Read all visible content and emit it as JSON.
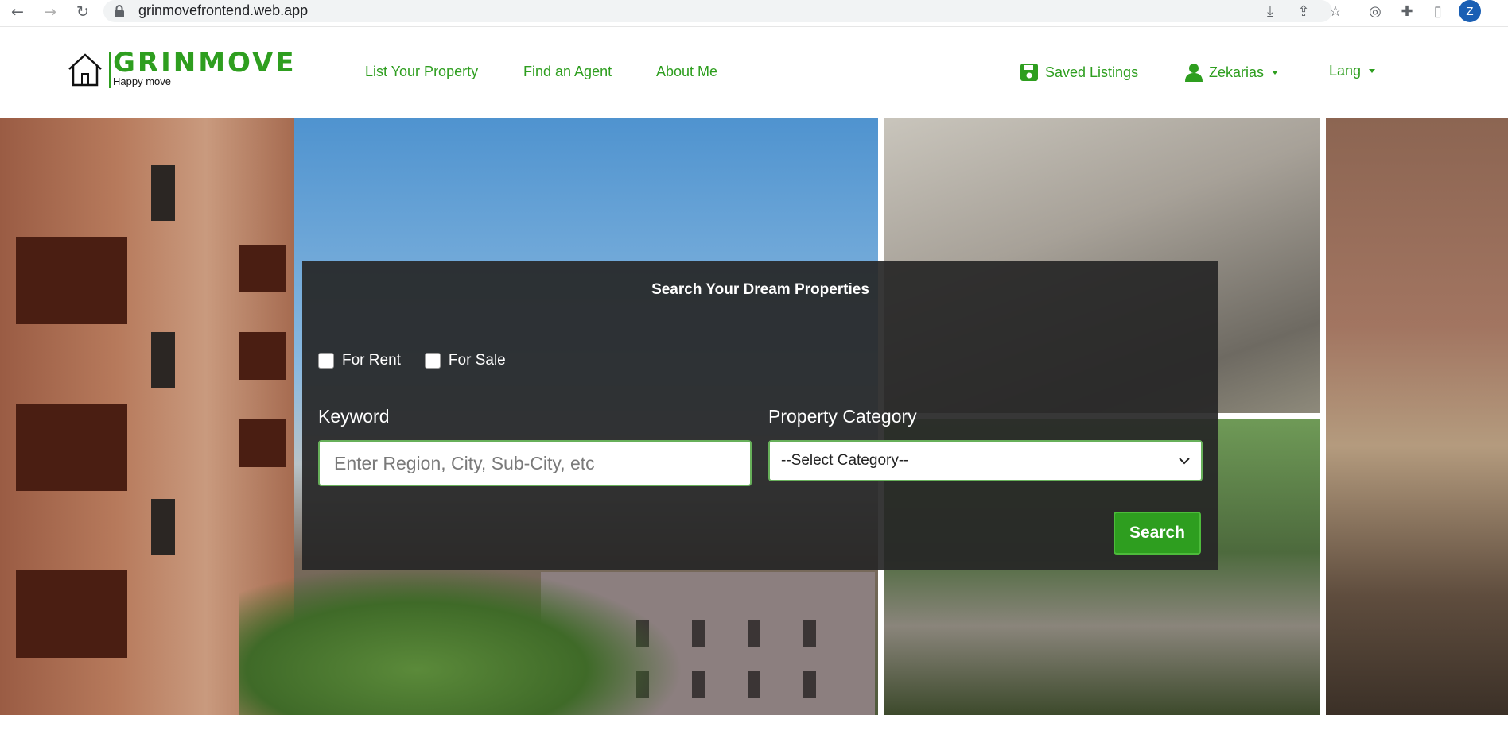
{
  "browser": {
    "url": "grinmovefrontend.web.app",
    "profile_initial": "Z"
  },
  "header": {
    "brand": "GRINMOVE",
    "tagline": "Happy move",
    "nav": [
      {
        "label": "List Your Property"
      },
      {
        "label": "Find an Agent"
      },
      {
        "label": "About Me"
      }
    ],
    "saved_listings": "Saved Listings",
    "user_name": "Zekarias",
    "lang": "Lang"
  },
  "search": {
    "title": "Search Your Dream Properties",
    "for_rent": "For Rent",
    "for_sale": "For Sale",
    "keyword_label": "Keyword",
    "keyword_placeholder": "Enter Region, City, Sub-City, etc",
    "category_label": "Property Category",
    "category_selected": "--Select Category--",
    "button": "Search"
  },
  "colors": {
    "brand_green": "#2e9e1f",
    "overlay": "#262626"
  }
}
